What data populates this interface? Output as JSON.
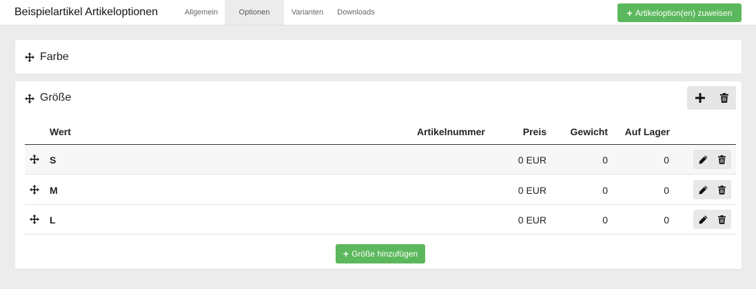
{
  "header": {
    "title": "Beispielartikel Artikeloptionen",
    "tabs": [
      "Allgemein",
      "Optionen",
      "Varianten",
      "Downloads"
    ],
    "active_tab": "Optionen",
    "assign_button": "Artikeloption(en) zuweisen"
  },
  "options": [
    {
      "title": "Farbe"
    },
    {
      "title": "Größe",
      "columns": [
        "Wert",
        "Artikelnummer",
        "Preis",
        "Gewicht",
        "Auf Lager"
      ],
      "rows": [
        {
          "wert": "S",
          "artikelnummer": "",
          "preis": "0 EUR",
          "gewicht": "0",
          "lager": "0"
        },
        {
          "wert": "M",
          "artikelnummer": "",
          "preis": "0 EUR",
          "gewicht": "0",
          "lager": "0"
        },
        {
          "wert": "L",
          "artikelnummer": "",
          "preis": "0 EUR",
          "gewicht": "0",
          "lager": "0"
        }
      ],
      "add_button": "Größe hinzufügen"
    }
  ],
  "icons": [
    "move-icon",
    "plus-icon",
    "trash-icon",
    "pencil-icon"
  ],
  "colors": {
    "accent": "#5cb85c",
    "background": "#ececec",
    "card": "#ffffff"
  }
}
